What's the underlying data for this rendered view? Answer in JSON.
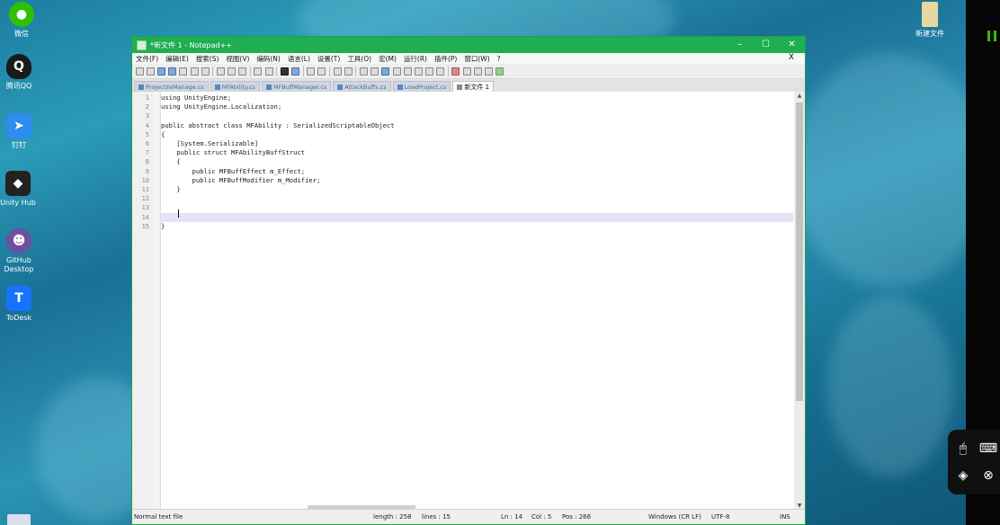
{
  "desktop": {
    "icons": [
      {
        "label": "微信",
        "icon": "wechat-icon",
        "color": "#2dc100"
      },
      {
        "label": "腾讯QQ",
        "icon": "qq-icon",
        "color": "#111111"
      },
      {
        "label": "钉钉",
        "icon": "dingtalk-icon",
        "color": "#2d8cf0"
      },
      {
        "label": "Unity Hub",
        "icon": "unity-icon",
        "color": "#222222"
      },
      {
        "label": "GitHub Desktop",
        "icon": "github-icon",
        "color": "#6e4fa0"
      },
      {
        "label": "ToDesk",
        "icon": "todesk-icon",
        "color": "#1673ff"
      }
    ],
    "file_label": "新建文件"
  },
  "window": {
    "title": "*新文件 1 - Notepad++",
    "accent": "#1fae52",
    "controls": {
      "min": "–",
      "max": "☐",
      "close": "✕"
    },
    "menu": [
      "文件(F)",
      "编辑(E)",
      "搜索(S)",
      "视图(V)",
      "编码(N)",
      "语言(L)",
      "设置(T)",
      "工具(O)",
      "宏(M)",
      "运行(R)",
      "插件(P)",
      "窗口(W)",
      "?"
    ],
    "menu_close": "X"
  },
  "tabs": [
    {
      "label": "ProjectileManage.cs"
    },
    {
      "label": "MFAbility.cs"
    },
    {
      "label": "MFBuffManager.cs"
    },
    {
      "label": "AttackBuffs.cs"
    },
    {
      "label": "LoadProject.cs"
    },
    {
      "label": "新文件 1",
      "active": true
    }
  ],
  "editor": {
    "line_numbers": [
      "1",
      "2",
      "3",
      "4",
      "5",
      "6",
      "7",
      "8",
      "9",
      "10",
      "11",
      "12",
      "13",
      "14",
      "15"
    ],
    "lines": [
      "using UnityEngine;",
      "using UnityEngine.Localization;",
      "",
      "public abstract class MFAbility : SerializedScriptableObject",
      "{",
      "    [System.Serializable]",
      "    public struct MFAbilityBuffStruct",
      "    {",
      "        public MFBuffEffect m_Effect;",
      "        public MFBuffModifier m_Modifier;",
      "    }",
      "",
      "",
      "",
      "}"
    ],
    "current_line": 14
  },
  "status": {
    "type": "Normal text file",
    "length": "length : 258",
    "lines": "lines : 15",
    "ln": "Ln : 14",
    "col": "Col : 5",
    "pos": "Pos : 266",
    "eol": "Windows (CR LF)",
    "encoding": "UTF-8",
    "mode": "INS"
  }
}
